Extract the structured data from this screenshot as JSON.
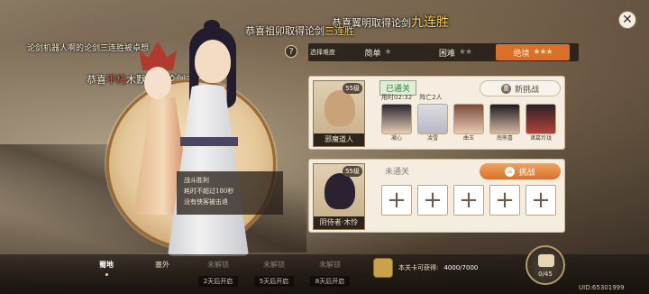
{
  "banners": {
    "b1_prefix": "恭喜翼明取得论剑",
    "b1_highlight": "九连胜",
    "b2_prefix": "恭喜祖卯取得论剑",
    "b2_highlight": "三连胜",
    "b3_text": "论剑机器人啊的论剑三连胜被卓想",
    "b4_prefix": "恭喜",
    "b4_highlight": "不朽",
    "b4_suffix": "木默取得论剑三连胜"
  },
  "help_label": "?",
  "close_label": "✕",
  "tooltip": {
    "lines": [
      "战斗胜利",
      "耗时不超过180秒",
      "没有侠客被击退"
    ]
  },
  "difficulty": {
    "caption": "选择难度",
    "options": [
      {
        "label": "简单",
        "stars": "★",
        "active": false
      },
      {
        "label": "困难",
        "stars": "★★",
        "active": false
      },
      {
        "label": "绝境",
        "stars": "★★★",
        "active": true
      }
    ]
  },
  "team1": {
    "leader_name": "邪魔道人",
    "leader_level": "55级",
    "status": "已通关",
    "time_label": "用时02:32",
    "deaths_label": "阵亡2人",
    "action_label": "新挑战",
    "action_icon": "重",
    "members": [
      {
        "name": "凝心"
      },
      {
        "name": "凌雪"
      },
      {
        "name": "曲玉"
      },
      {
        "name": "南熊喜"
      },
      {
        "name": "诸葛玲珑"
      }
    ]
  },
  "team2": {
    "leader_name": "阴侍者·木怜",
    "leader_level": "55级",
    "status": "未通关",
    "action_label": "挑战",
    "action_icon": "⚔",
    "slots": [
      "+",
      "+",
      "+",
      "+",
      "+"
    ]
  },
  "regions": [
    {
      "name": "蜀地",
      "sub": "",
      "state": "current"
    },
    {
      "name": "塞外",
      "sub": "",
      "state": "open"
    },
    {
      "name": "未解锁",
      "sub": "2天后开启",
      "state": "locked"
    },
    {
      "name": "未解锁",
      "sub": "5天后开启",
      "state": "locked"
    },
    {
      "name": "未解锁",
      "sub": "8天后开启",
      "state": "locked"
    }
  ],
  "reward": {
    "label": "本关卡可获得:",
    "progress": "4000/7000"
  },
  "chest": {
    "count": "0/45"
  },
  "uid": "UID:65301999",
  "colors": {
    "accent": "#d9702a",
    "cleared": "#2f7d3a"
  }
}
